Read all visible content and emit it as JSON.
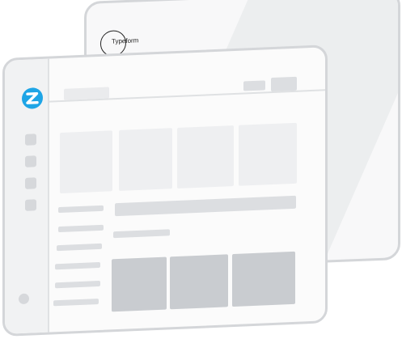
{
  "back_window": {
    "logo_text": "Typeform"
  },
  "front_window": {
    "app_logo_icon": "zendesk-z-icon"
  },
  "colors": {
    "accent": "#1ea5e6",
    "frame": "#d4d6d9",
    "placeholder": "#dcdee1",
    "placeholder_dark": "#c9ccd0",
    "card": "#eeeff1"
  }
}
